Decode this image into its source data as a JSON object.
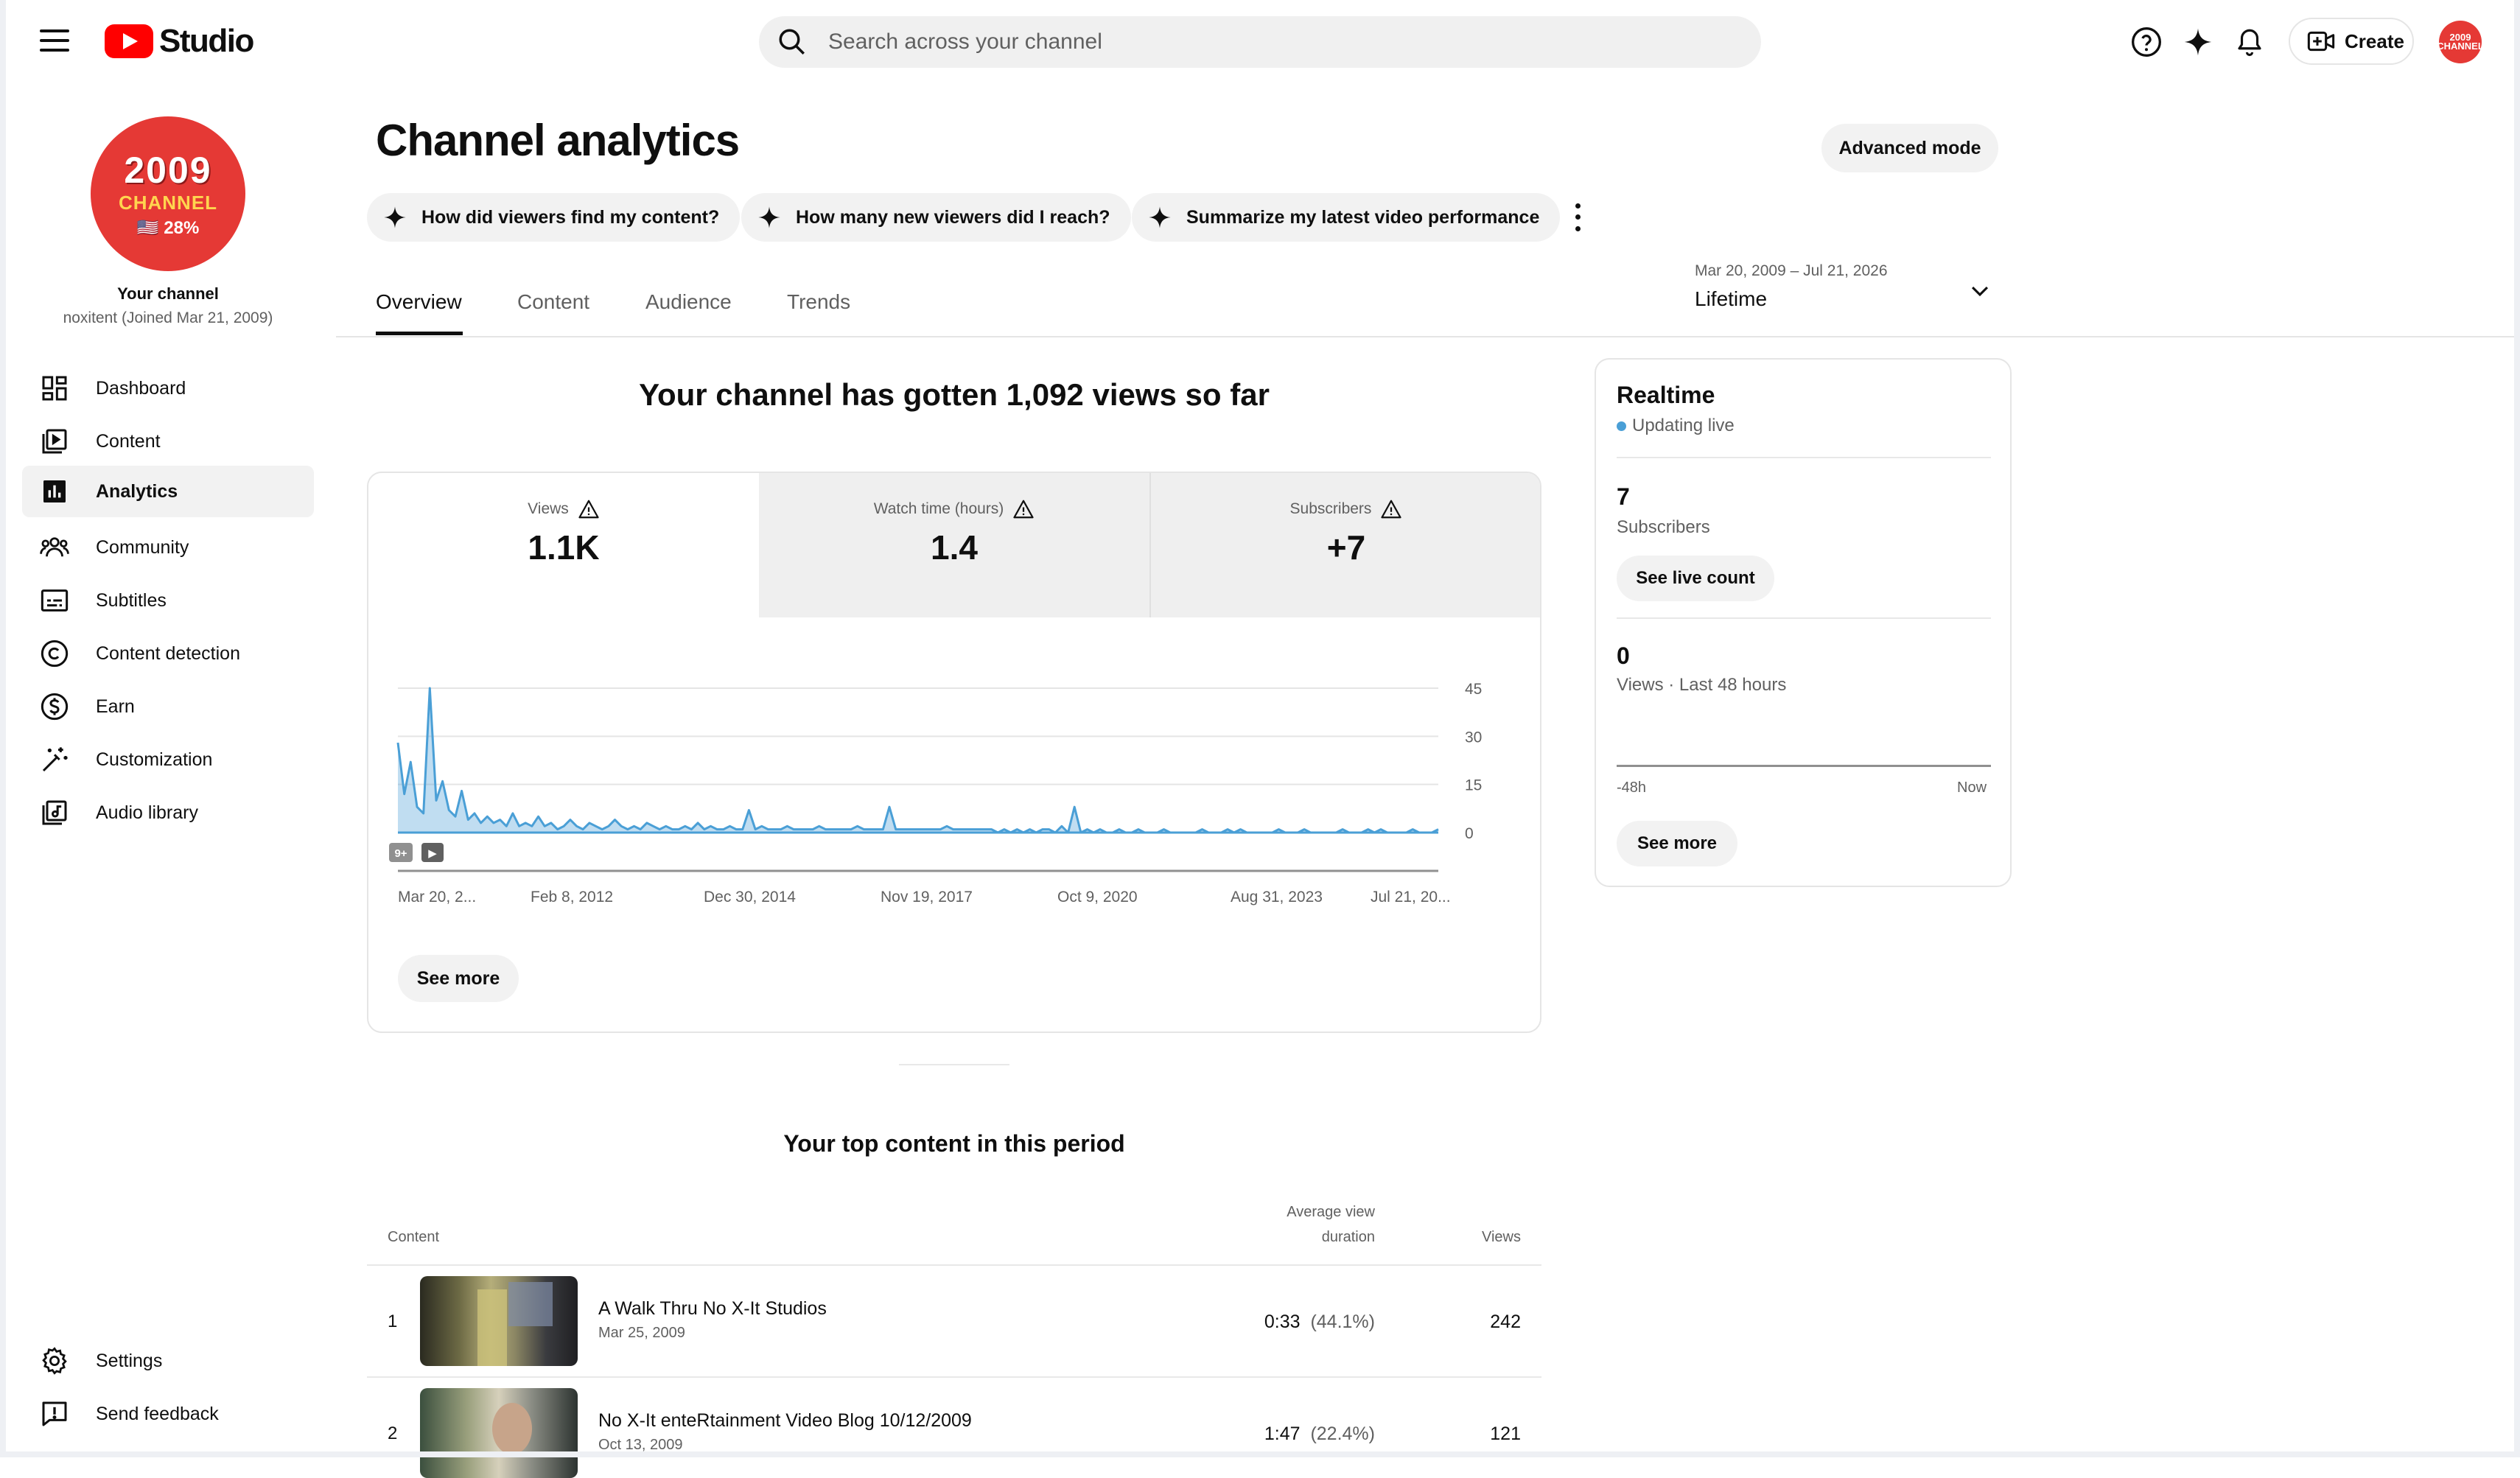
{
  "header": {
    "logo_text": "Studio",
    "search_placeholder": "Search across your channel",
    "create_label": "Create",
    "avatar_text": "2009 CHANNEL"
  },
  "sidebar": {
    "avatar": {
      "year": "2009",
      "word": "CHANNEL",
      "pct": "🇺🇸 28%"
    },
    "your_channel": "Your channel",
    "joined": "noxitent (Joined Mar 21, 2009)",
    "items": [
      {
        "label": "Dashboard",
        "icon": "dashboard-icon"
      },
      {
        "label": "Content",
        "icon": "content-icon"
      },
      {
        "label": "Analytics",
        "icon": "analytics-icon"
      },
      {
        "label": "Community",
        "icon": "community-icon"
      },
      {
        "label": "Subtitles",
        "icon": "subtitles-icon"
      },
      {
        "label": "Content detection",
        "icon": "copyright-icon"
      },
      {
        "label": "Earn",
        "icon": "dollar-icon"
      },
      {
        "label": "Customization",
        "icon": "magic-wand-icon"
      },
      {
        "label": "Audio library",
        "icon": "audio-library-icon"
      }
    ],
    "bottom": [
      {
        "label": "Settings",
        "icon": "gear-icon"
      },
      {
        "label": "Send feedback",
        "icon": "feedback-icon"
      }
    ]
  },
  "page": {
    "title": "Channel analytics",
    "advanced_mode": "Advanced mode",
    "chips": [
      "How did viewers find my content?",
      "How many new viewers did I reach?",
      "Summarize my latest video performance"
    ],
    "tabs": [
      "Overview",
      "Content",
      "Audience",
      "Trends"
    ],
    "active_tab": "Overview",
    "date_range": {
      "range": "Mar 20, 2009 – Jul 21, 2026",
      "label": "Lifetime"
    }
  },
  "overview": {
    "headline": "Your channel has gotten 1,092 views so far",
    "metrics": [
      {
        "label": "Views",
        "value": "1.1K"
      },
      {
        "label": "Watch time (hours)",
        "value": "1.4"
      },
      {
        "label": "Subscribers",
        "value": "+7"
      }
    ],
    "see_more": "See more"
  },
  "chart_data": {
    "type": "line",
    "title": "",
    "ylabel": "",
    "ylim": [
      0,
      45
    ],
    "y_ticks": [
      "45",
      "30",
      "15",
      "0"
    ],
    "x_ticks": [
      "Mar 20, 2...",
      "Feb 8, 2012",
      "Dec 30, 2014",
      "Nov 19, 2017",
      "Oct 9, 2020",
      "Aug 31, 2023",
      "Jul 21, 20..."
    ],
    "markers": [
      "9+",
      "▶"
    ],
    "color": "#4a9fd6",
    "series": [
      {
        "values": [
          28,
          12,
          22,
          8,
          6,
          45,
          10,
          16,
          7,
          5,
          13,
          4,
          6,
          3,
          5,
          3,
          4,
          2,
          6,
          2,
          3,
          2,
          5,
          2,
          3,
          1,
          2,
          4,
          2,
          1,
          3,
          2,
          1,
          2,
          4,
          2,
          1,
          2,
          1,
          3,
          2,
          1,
          2,
          1,
          1,
          2,
          1,
          3,
          1,
          2,
          1,
          1,
          2,
          1,
          1,
          7,
          1,
          2,
          1,
          1,
          1,
          2,
          1,
          1,
          1,
          1,
          2,
          1,
          1,
          1,
          1,
          1,
          2,
          1,
          1,
          1,
          1,
          8,
          1,
          1,
          1,
          1,
          1,
          1,
          1,
          1,
          2,
          1,
          1,
          1,
          1,
          1,
          1,
          1,
          0,
          1,
          0,
          1,
          0,
          1,
          0,
          1,
          1,
          0,
          2,
          0,
          8,
          0,
          1,
          0,
          1,
          0,
          0,
          1,
          0,
          0,
          1,
          0,
          0,
          0,
          1,
          0,
          0,
          0,
          0,
          0,
          1,
          0,
          0,
          0,
          1,
          0,
          1,
          0,
          0,
          0,
          0,
          0,
          1,
          0,
          0,
          0,
          1,
          0,
          0,
          0,
          0,
          0,
          1,
          0,
          0,
          0,
          1,
          0,
          1,
          0,
          0,
          0,
          0,
          1,
          0,
          0,
          0,
          1
        ]
      }
    ]
  },
  "realtime": {
    "title": "Realtime",
    "status": "Updating live",
    "subscribers_value": "7",
    "subscribers_label": "Subscribers",
    "see_live_count": "See live count",
    "views_value": "0",
    "views_label": "Views · Last 48 hours",
    "axis_start": "-48h",
    "axis_end": "Now",
    "see_more": "See more"
  },
  "top_content": {
    "title": "Your top content in this period",
    "headers": {
      "content": "Content",
      "avg_line1": "Average view",
      "avg_line2": "duration",
      "views": "Views"
    },
    "rows": [
      {
        "rank": "1",
        "title": "A Walk Thru No X-It Studios",
        "date": "Mar 25, 2009",
        "avg": "0:33",
        "pct": "(44.1%)",
        "views": "242"
      },
      {
        "rank": "2",
        "title": "No X-It enteRtainment Video Blog 10/12/2009",
        "date": "Oct 13, 2009",
        "avg": "1:47",
        "pct": "(22.4%)",
        "views": "121"
      }
    ]
  }
}
